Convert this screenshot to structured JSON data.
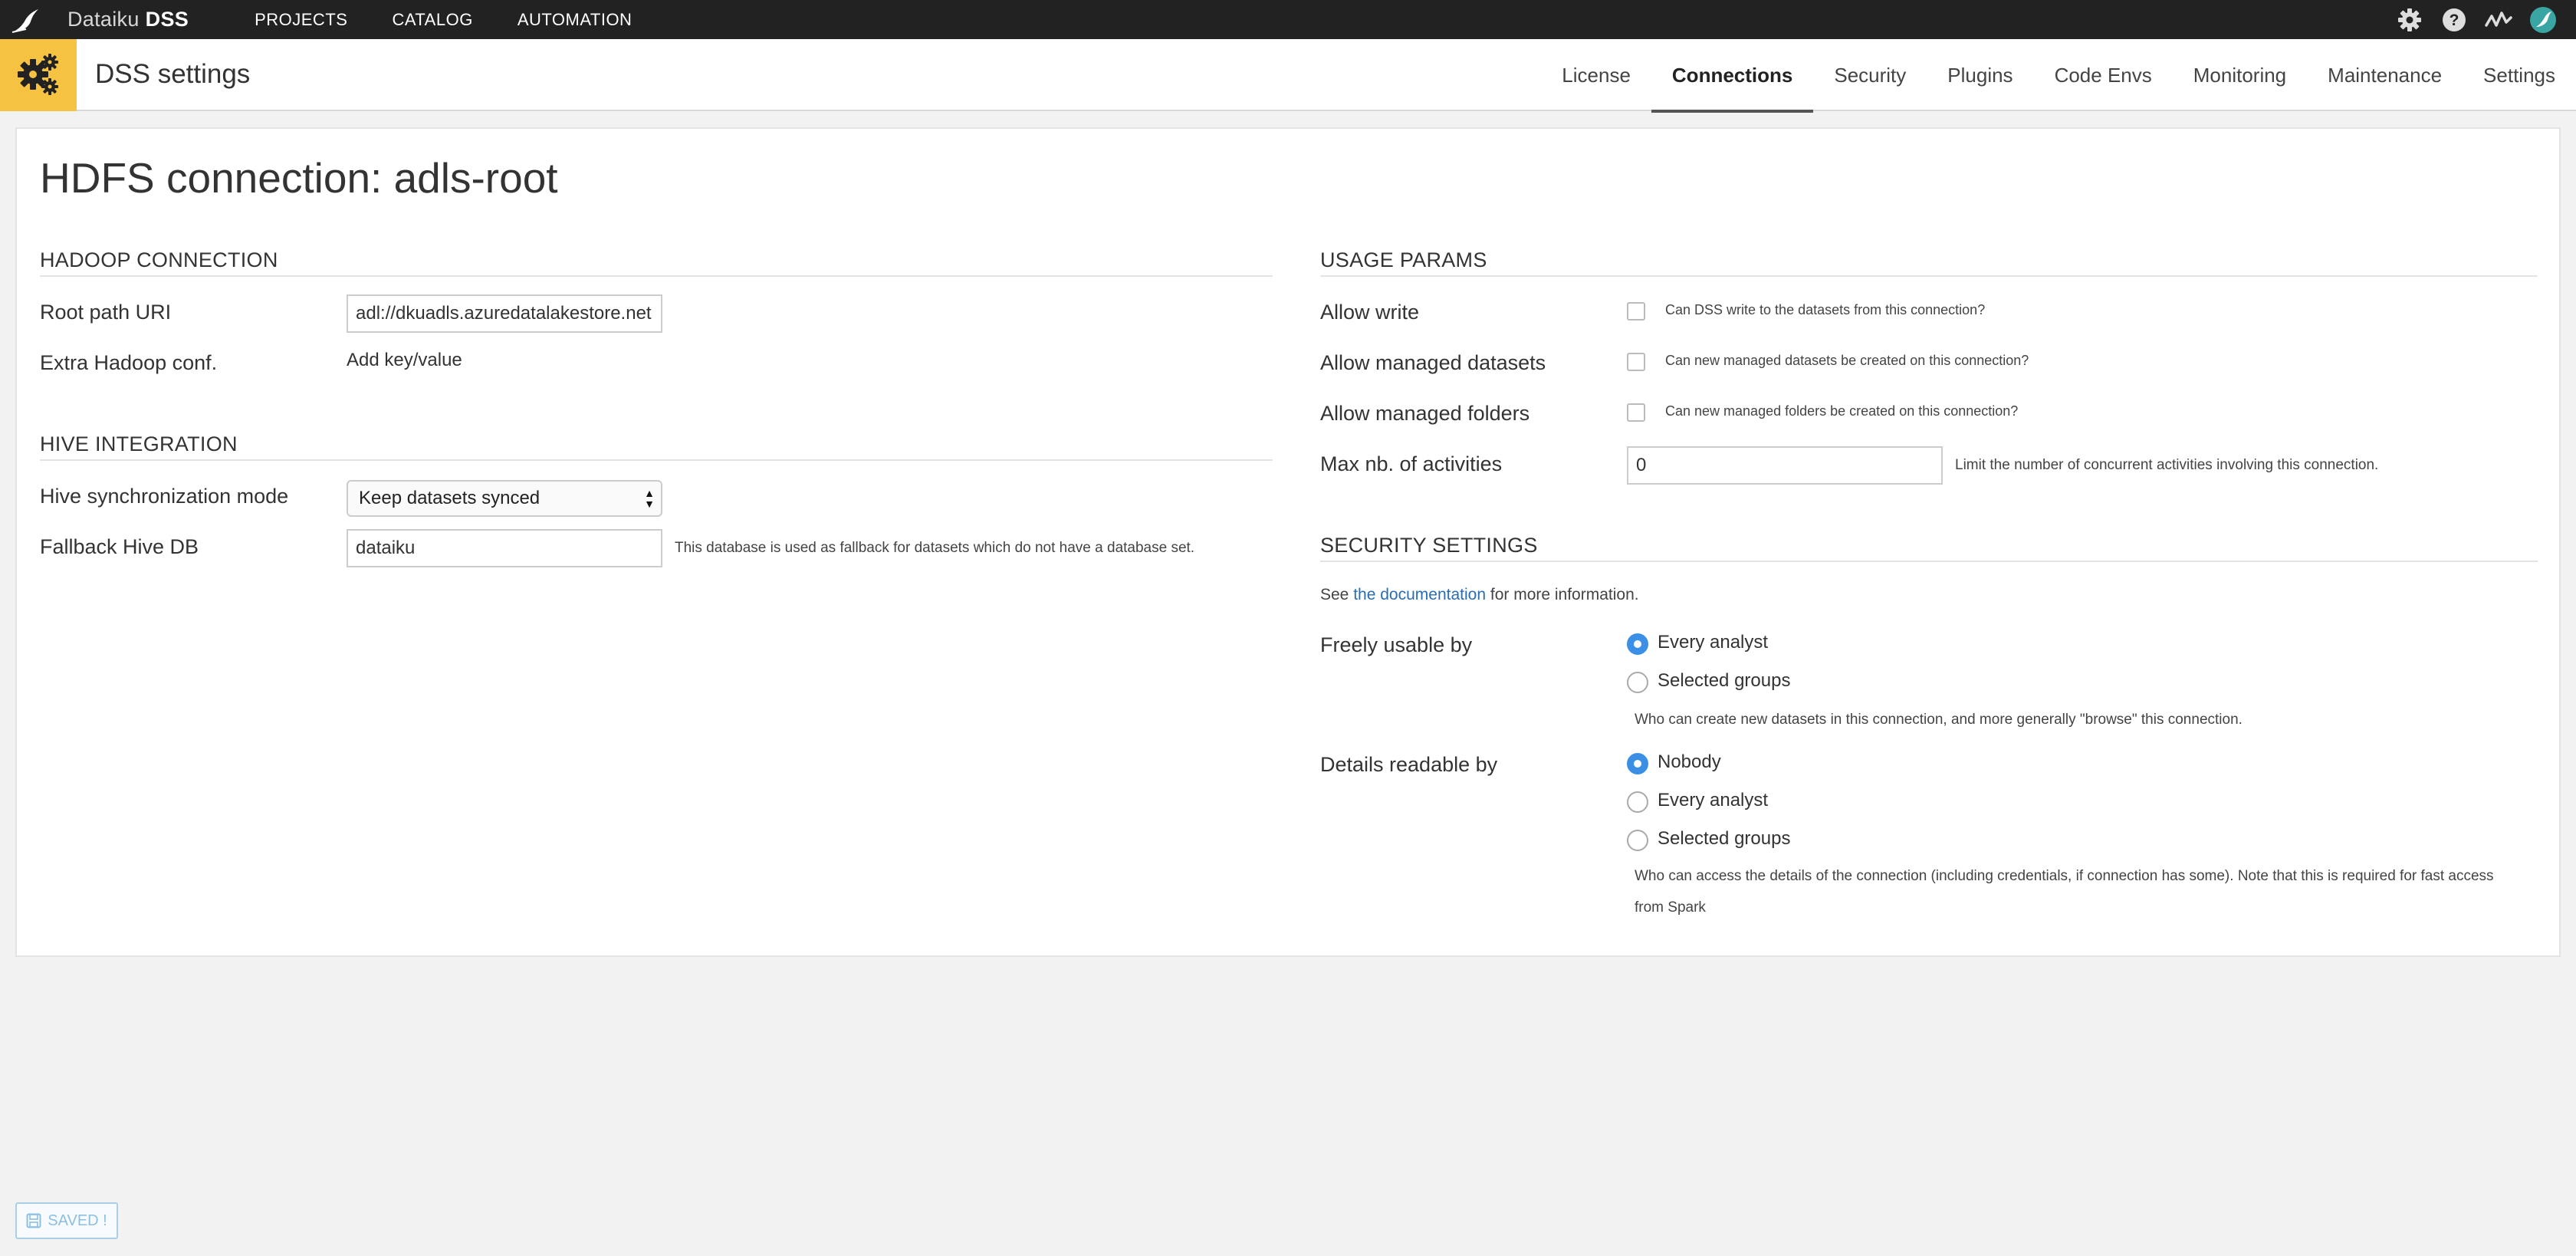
{
  "topbar": {
    "brand_name": "Dataiku",
    "brand_product": "DSS",
    "nav": [
      "PROJECTS",
      "CATALOG",
      "AUTOMATION"
    ],
    "icons": [
      "gear-icon",
      "help-icon",
      "activity-icon",
      "avatar-icon"
    ]
  },
  "header": {
    "title": "DSS settings",
    "tabs": [
      "License",
      "Connections",
      "Security",
      "Plugins",
      "Code Envs",
      "Monitoring",
      "Maintenance",
      "Settings"
    ],
    "active_tab": "Connections"
  },
  "page": {
    "title": "HDFS connection: adls-root"
  },
  "hadoop": {
    "section_title": "HADOOP CONNECTION",
    "root_path_label": "Root path URI",
    "root_path_value": "adl://dkuadls.azuredatalakestore.net",
    "extra_conf_label": "Extra Hadoop conf.",
    "add_kv_label": "Add key/value"
  },
  "hive": {
    "section_title": "HIVE INTEGRATION",
    "sync_mode_label": "Hive synchronization mode",
    "sync_mode_value": "Keep datasets synced",
    "fallback_db_label": "Fallback Hive DB",
    "fallback_db_value": "dataiku",
    "fallback_db_help": "This database is used as fallback for datasets which do not have a database set."
  },
  "usage": {
    "section_title": "USAGE PARAMS",
    "allow_write_label": "Allow write",
    "allow_write_help": "Can DSS write to the datasets from this connection?",
    "allow_managed_datasets_label": "Allow managed datasets",
    "allow_managed_datasets_help": "Can new managed datasets be created on this connection?",
    "allow_managed_folders_label": "Allow managed folders",
    "allow_managed_folders_help": "Can new managed folders be created on this connection?",
    "max_activities_label": "Max nb. of activities",
    "max_activities_value": "0",
    "max_activities_help": "Limit the number of concurrent activities involving this connection."
  },
  "security": {
    "section_title": "SECURITY SETTINGS",
    "see_prefix": "See",
    "doc_link": "the documentation",
    "see_suffix": "for more information.",
    "freely_usable_label": "Freely usable by",
    "freely_options": [
      "Every analyst",
      "Selected groups"
    ],
    "freely_selected": "Every analyst",
    "freely_help": "Who can create new datasets in this connection, and more generally \"browse\" this connection.",
    "details_label": "Details readable by",
    "details_options": [
      "Nobody",
      "Every analyst",
      "Selected groups"
    ],
    "details_selected": "Nobody",
    "details_help_line1": "Who can access the details of the connection (including credentials, if connection has some). Note that this is required for fast access",
    "details_help_line2": "from Spark"
  },
  "footer": {
    "saved_label": "SAVED !"
  },
  "colors": {
    "topbar_bg": "#222222",
    "accent_yellow": "#f5c242",
    "radio_blue": "#3b8fe5",
    "link_blue": "#2a6db2"
  }
}
